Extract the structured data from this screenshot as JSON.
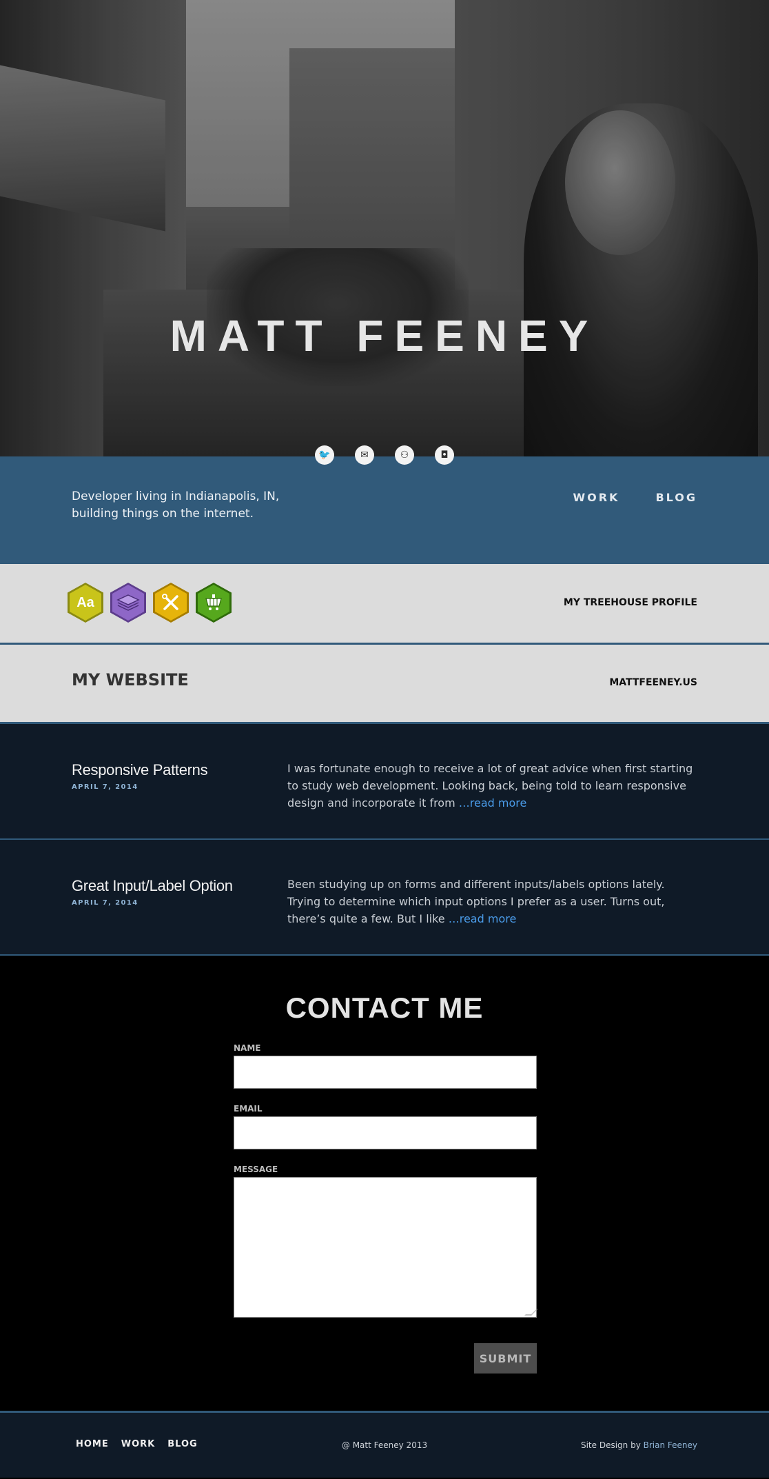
{
  "hero": {
    "title": "MATT FEENEY",
    "social": [
      {
        "icon": "twitter-icon",
        "glyph": "🐦"
      },
      {
        "icon": "mail-icon",
        "glyph": "✉"
      },
      {
        "icon": "github-icon",
        "glyph": "⚇"
      },
      {
        "icon": "instagram-icon",
        "glyph": "◘"
      }
    ]
  },
  "intro": {
    "tagline": "Developer living in Indianapolis, IN, building things on the internet.",
    "nav": [
      {
        "label": "WORK"
      },
      {
        "label": "BLOG"
      }
    ]
  },
  "treehouse": {
    "badges": [
      "typography-badge",
      "layers-badge",
      "tools-badge",
      "cart-badge"
    ],
    "badge1_text": "Aa",
    "link": "MY TREEHOUSE PROFILE"
  },
  "website": {
    "heading": "MY WEBSITE",
    "link": "MATTFEENEY.US"
  },
  "posts": [
    {
      "title": "Responsive Patterns",
      "date": "APRIL 7, 2014",
      "excerpt": "I was fortunate enough to receive a lot of great advice when first starting to study web development. Looking back, being told to learn responsive design and incorporate it from ",
      "more": "…read more"
    },
    {
      "title": "Great Input/Label Option",
      "date": "APRIL 7, 2014",
      "excerpt": "Been studying up on forms and different inputs/labels options lately. Trying to determine which input options I prefer as a user. Turns out, there’s quite a few. But I like ",
      "more": "…read more"
    }
  ],
  "contact": {
    "heading": "CONTACT ME",
    "name_label": "NAME",
    "email_label": "EMAIL",
    "message_label": "MESSAGE",
    "name_value": "",
    "email_value": "",
    "message_value": "",
    "submit": "SUBMIT"
  },
  "footer": {
    "nav": [
      {
        "label": "HOME"
      },
      {
        "label": "WORK"
      },
      {
        "label": "BLOG"
      }
    ],
    "copyright": "@ Matt Feeney 2013",
    "credit_prefix": "Site Design by ",
    "credit_name": "Brian Feeney"
  },
  "colors": {
    "accent_blue": "#315a7a",
    "dark_navy": "#0f1a27",
    "link_blue": "#4a9be8"
  }
}
